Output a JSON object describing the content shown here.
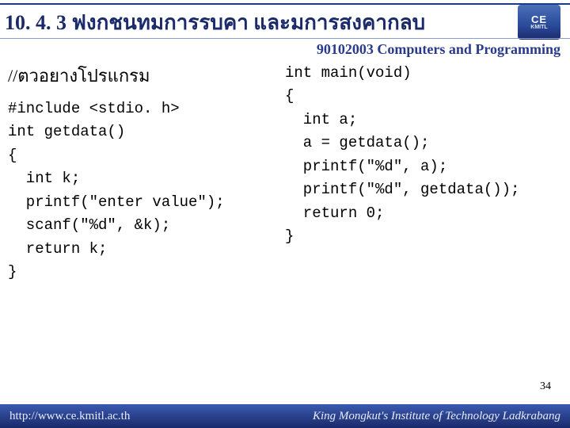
{
  "header": {
    "title": "10. 4. 3 ฟงกชนทมการรบคา   และมการสงคากลบ"
  },
  "logo": {
    "line1": "CE",
    "line2": "KMITL"
  },
  "course_label": "90102003 Computers and Programming",
  "subtitle": "//ตวอยางโปรแกรม",
  "code_left": "#include <stdio. h>\nint getdata()\n{\n  int k;\n  printf(\"enter value\");\n  scanf(\"%d\", &k);\n  return k;\n}",
  "code_right": "int main(void)\n{\n  int a;\n  a = getdata();\n  printf(\"%d\", a);\n  printf(\"%d\", getdata());\n  return 0;\n}",
  "page_number": "34",
  "footer": {
    "url": "http://www.ce.kmitl.ac.th",
    "org": "King Mongkut's Institute of Technology Ladkrabang"
  }
}
